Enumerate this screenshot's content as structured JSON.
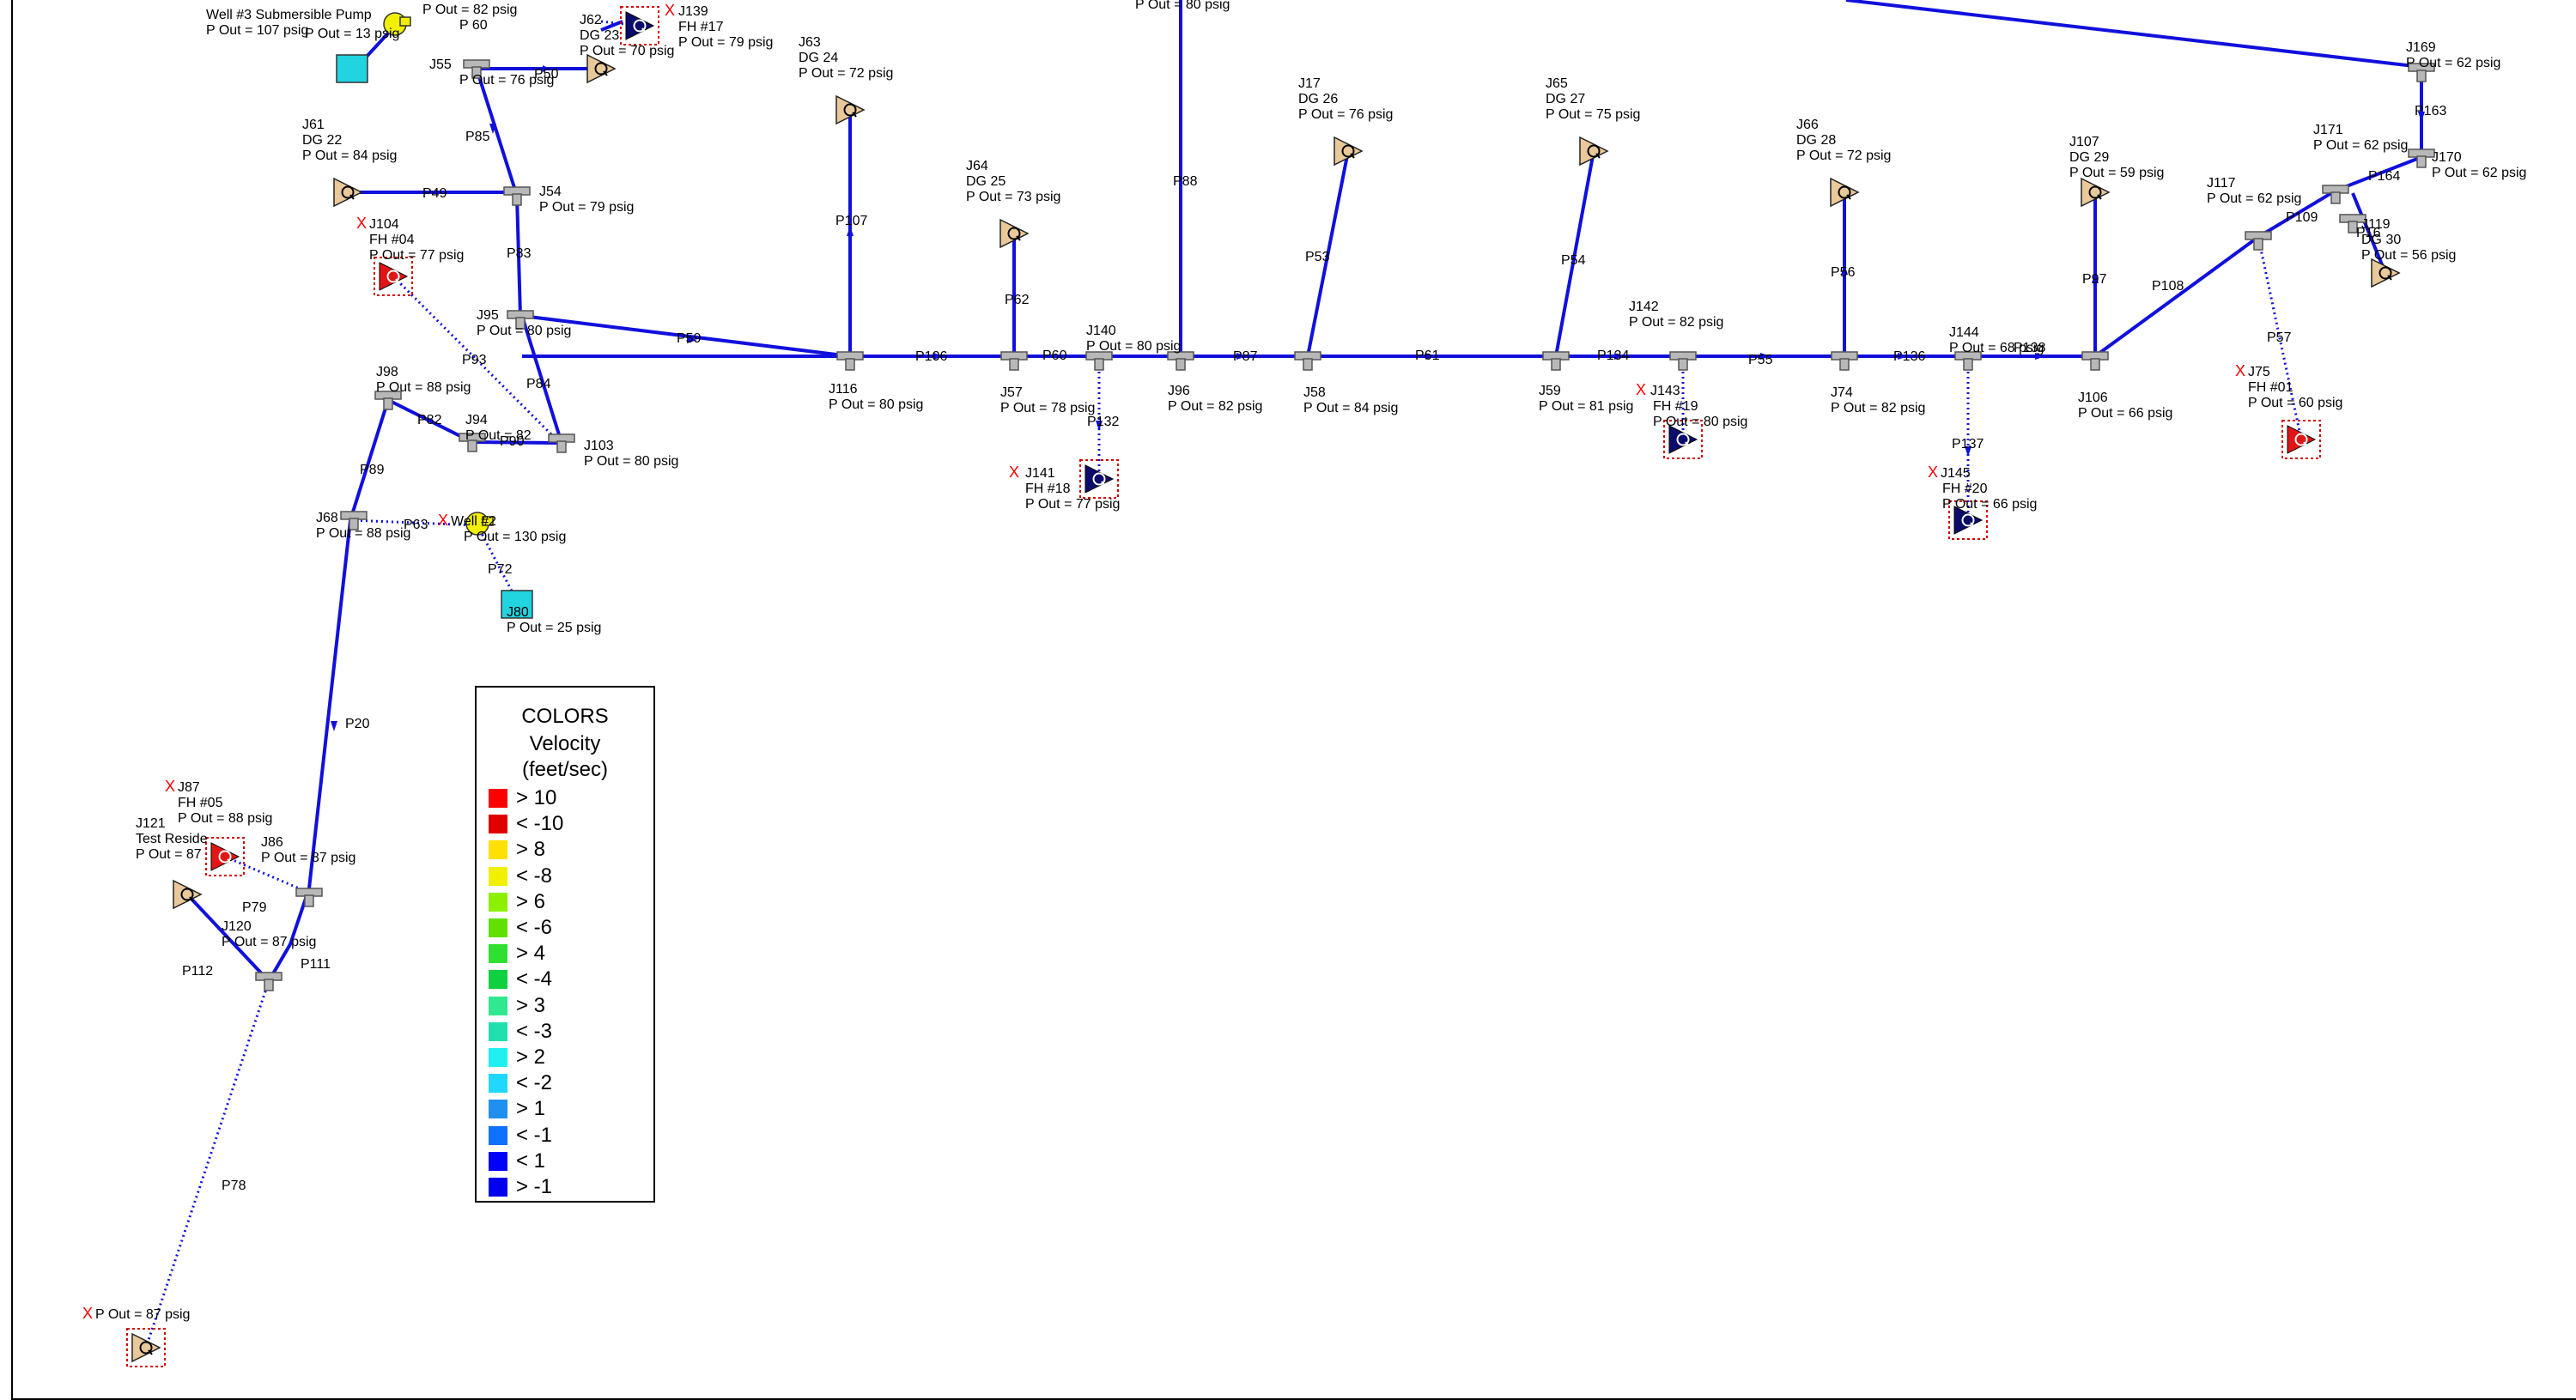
{
  "colors": {
    "pipe_blue": "#1010dd",
    "tee_gray": "#b8b8b8",
    "dg_tan": "#e9c99a",
    "fh_navy": "#0b0b6b",
    "fh_red": "#e11515",
    "well_yellow": "#f0f000",
    "tank_cyan": "#22d3e0",
    "x_red": "#ff0000"
  },
  "legend": {
    "title": "COLORS",
    "subtitle_1": "Velocity",
    "subtitle_2": "(feet/sec)",
    "items": [
      {
        "label": "> 10",
        "color": "#ff0000"
      },
      {
        "label": "< -10",
        "color": "#e00000"
      },
      {
        "label": "> 8",
        "color": "#ffe000"
      },
      {
        "label": "< -8",
        "color": "#f0f000"
      },
      {
        "label": "> 6",
        "color": "#8cf000"
      },
      {
        "label": "< -6",
        "color": "#60e000"
      },
      {
        "label": "> 4",
        "color": "#30e030"
      },
      {
        "label": "< -4",
        "color": "#10d040"
      },
      {
        "label": "> 3",
        "color": "#30e890"
      },
      {
        "label": "< -3",
        "color": "#20e0b0"
      },
      {
        "label": "> 2",
        "color": "#20f0f0"
      },
      {
        "label": "< -2",
        "color": "#20d8ff"
      },
      {
        "label": "> 1",
        "color": "#2090f0"
      },
      {
        "label": "< -1",
        "color": "#1070ff"
      },
      {
        "label": "< 1",
        "color": "#0000ff"
      },
      {
        "label": "> -1",
        "color": "#0000ee"
      }
    ]
  },
  "nodes": {
    "well3_name": "Well #3 Submersible Pump",
    "well3_pout": "P Out = 107 psig",
    "well3_tank_pout": "P Out = 13 psig",
    "p60_pout": "P Out = 82 psig",
    "p60_label": "P 60",
    "j62_name": "J62",
    "j62_dg": "DG 23",
    "j62_pout": "P Out = 70 psig",
    "j139_name": "J139",
    "j139_fh": "FH #17",
    "j139_pout": "P Out = 79 psig",
    "j55_name": "J55",
    "j55_pout": "P Out = 76 psig",
    "j63_name": "J63",
    "j63_dg": "DG 24",
    "j63_pout": "P Out = 72 psig",
    "j61_name": "J61",
    "j61_dg": "DG 22",
    "j61_pout": "P Out = 84 psig",
    "j54_name": "J54",
    "j54_pout": "P Out = 79 psig",
    "j104_name": "J104",
    "j104_fh": "FH #04",
    "j104_pout": "P Out = 77 psig",
    "j95_name": "J95",
    "j95_pout": "P Out = 80 psig",
    "j98_name": "J98",
    "j98_pout": "P Out = 88 psig",
    "j94_name": "J94",
    "j94_pout": "P Out = 82",
    "j103_name": "J103",
    "j103_pout": "P Out = 80 psig",
    "j68_name": "J68",
    "j68_pout": "P Out = 88 psig",
    "well2_name": "Well #2",
    "well2_pout": "P Out = 130 psig",
    "j80_name": "J80",
    "j80_pout": "P Out = 25 psig",
    "j116_name": "J116",
    "j116_pout": "P Out = 80 psig",
    "j64_name": "J64",
    "j64_dg": "DG 25",
    "j64_pout": "P Out = 73 psig",
    "j57_name": "J57",
    "j57_pout": "P Out = 78 psig",
    "j140_name": "J140",
    "j140_pout": "P Out = 80 psig",
    "j141_name": "J141",
    "j141_fh": "FH #18",
    "j141_pout": "P Out = 77 psig",
    "j96_name": "J96",
    "j96_pout": "P Out = 82 psig",
    "j17_name": "J17",
    "j17_dg": "DG 26",
    "j17_pout": "P Out = 76 psig",
    "j58_name": "J58",
    "j58_pout": "P Out = 84 psig",
    "j65_name": "J65",
    "j65_dg": "DG 27",
    "j65_pout": "P Out = 75 psig",
    "j59_name": "J59",
    "j59_pout": "P Out = 81 psig",
    "j142_name": "J142",
    "j142_pout": "P Out = 82 psig",
    "j143_name": "J143",
    "j143_fh": "FH #19",
    "j143_pout": "P Out = 80 psig",
    "j66_name": "J66",
    "j66_dg": "DG 28",
    "j66_pout": "P Out = 72 psig",
    "j74_name": "J74",
    "j74_pout": "P Out = 82 psig",
    "j144_name": "J144",
    "j144_pout": "P Out = 68 psig",
    "j145_name": "J145",
    "j145_fh": "FH #20",
    "j145_pout": "P Out = 66 psig",
    "j107_name": "J107",
    "j107_dg": "DG 29",
    "j107_pout": "P Out = 59 psig",
    "j106_name": "J106",
    "j106_pout": "P Out = 66 psig",
    "j169_name": "J169",
    "j169_pout": "P Out = 62 psig",
    "j171_name": "J171",
    "j171_pout": "P Out = 62 psig",
    "j170_name": "J170",
    "j170_pout": "P Out = 62 psig",
    "j117_name": "J117",
    "j117_pout": "P Out = 62 psig",
    "j119_name": "J119",
    "j119_dg": "DG 30",
    "j119_pout": "P Out = 56 psig",
    "j75_name": "J75",
    "j75_fh": "FH #01",
    "j75_pout": "P Out = 60 psig",
    "j87_name": "J87",
    "j87_fh": "FH #05",
    "j87_pout": "P Out = 88 psig",
    "j121_name": "J121",
    "j121_test": "Test Reside",
    "j121_pout": "P Out = 87",
    "j86_name": "J86",
    "j86_pout": "P Out = 87 psig",
    "j120_name": "J120",
    "j120_pout": "P Out = 87 psig",
    "bottom_pout": "P Out = 87 psig",
    "top_pout_frag": "P Out = 80 psig"
  },
  "pipes": {
    "p50": "P50",
    "p85": "P85",
    "p49": "P49",
    "p83": "P83",
    "p59": "P59",
    "p93": "P93",
    "p84": "P84",
    "p82": "P82",
    "p90": "P90",
    "p89": "P89",
    "p63": "P63",
    "p72": "P72",
    "p20": "P20",
    "p79": "P79",
    "p112": "P112",
    "p111": "P111",
    "p78": "P78",
    "p107": "P107",
    "p106": "P106",
    "p62": "P62",
    "p60b": "P60",
    "p132": "P132",
    "p88": "P88",
    "p87": "P87",
    "p53": "P53",
    "p61": "P61",
    "p54": "P54",
    "p134": "P134",
    "p55": "P55",
    "p56": "P56",
    "p136": "P136",
    "p137": "P137",
    "p138": "P138",
    "p97": "P97",
    "p108": "P108",
    "p57": "P57",
    "p109": "P109",
    "p163": "P163",
    "p164": "P164",
    "p16": "P16"
  }
}
